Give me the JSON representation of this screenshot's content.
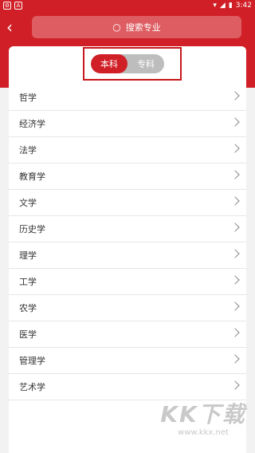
{
  "status_bar": {
    "time": "3:42"
  },
  "header": {
    "back_icon": "chevron-left-icon",
    "search_placeholder": "搜索专业"
  },
  "toggle": {
    "options": [
      "本科",
      "专科"
    ],
    "selected": "本科"
  },
  "majors": [
    "哲学",
    "经济学",
    "法学",
    "教育学",
    "文学",
    "历史学",
    "理学",
    "工学",
    "农学",
    "医学",
    "管理学",
    "艺术学"
  ],
  "watermark": {
    "title": "KK下载",
    "url": "www.kkx.net"
  }
}
